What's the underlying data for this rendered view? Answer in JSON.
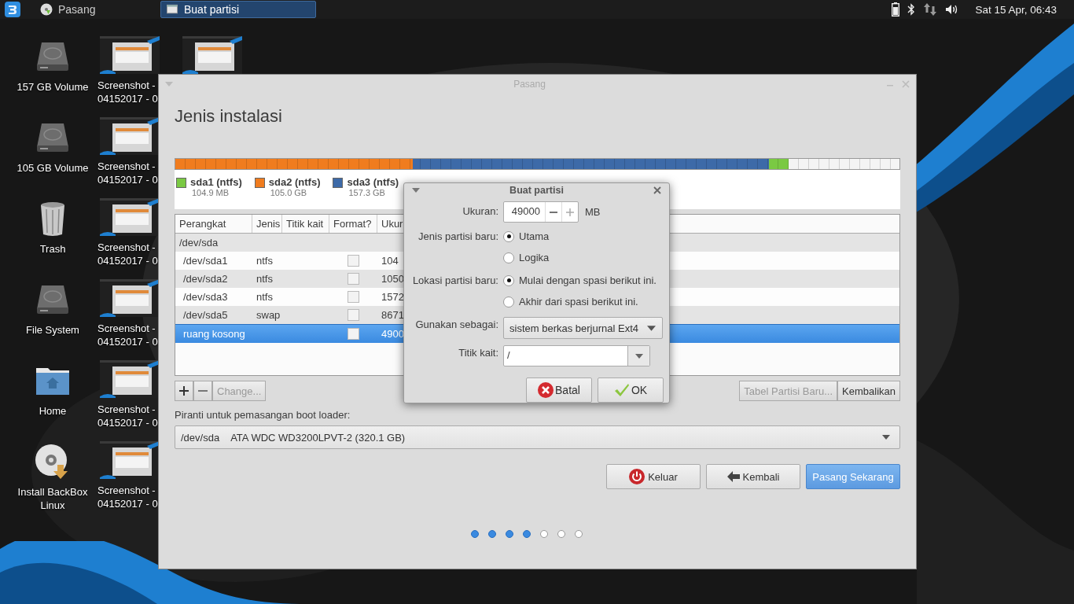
{
  "top_panel": {
    "tasks": [
      {
        "label": "Pasang",
        "kind": "installer",
        "selected": false
      },
      {
        "label": "Buat partisi",
        "kind": "window",
        "selected": true
      }
    ],
    "clock": "Sat 15 Apr, 06:43"
  },
  "desktop_icons": [
    {
      "label": "157 GB Volume",
      "kind": "drive"
    },
    {
      "label": "105 GB Volume",
      "kind": "drive"
    },
    {
      "label": "Trash",
      "kind": "trash"
    },
    {
      "label": "File System",
      "kind": "drive"
    },
    {
      "label": "Home",
      "kind": "folder"
    },
    {
      "label": "Install BackBox Linux",
      "kind": "disc"
    }
  ],
  "desktop_files": [
    {
      "kind": "screenshot",
      "lines": [
        "Screenshot -",
        "04152017 - 0"
      ]
    },
    {
      "kind": "screenshot",
      "lines": [
        "Screenshot -",
        "04152017 - 0"
      ]
    },
    {
      "kind": "screenshot",
      "lines": [
        "Screenshot -",
        "04152017 - 0"
      ]
    },
    {
      "kind": "screenshot",
      "lines": [
        "Screenshot -",
        "04152017 - 0"
      ]
    },
    {
      "kind": "screenshot",
      "lines": [
        "Screenshot -",
        "04152017 - 0"
      ]
    },
    {
      "kind": "screenshot",
      "lines": [
        "Screenshot -",
        "04152017 - 0"
      ]
    },
    {
      "kind": "screenshot"
    }
  ],
  "window": {
    "title": "Pasang",
    "heading": "Jenis instalasi",
    "partition_bar": [
      {
        "color": "#7ac943",
        "level": 0.847
      },
      {
        "color": "#3d6aa8",
        "level": 0.82
      },
      {
        "color": "#f07c1e",
        "level": 0.328
      }
    ],
    "legend": [
      {
        "name": "sda1 (ntfs)",
        "size": "104.9 MB",
        "color": "#7ac943"
      },
      {
        "name": "sda2 (ntfs)",
        "size": "105.0 GB",
        "color": "#f07c1e"
      },
      {
        "name": "sda3 (ntfs)",
        "size": "157.3 GB",
        "color": "#3d6aa8"
      }
    ],
    "table": {
      "columns": [
        "Perangkat",
        "Jenis",
        "Titik kait",
        "Format?",
        "Ukur"
      ],
      "rows": [
        {
          "kind": "group",
          "device": "/dev/sda",
          "selected": false
        },
        {
          "kind": "partition",
          "device": "/dev/sda1",
          "type": "ntfs",
          "format": false,
          "size": "104",
          "selected": false
        },
        {
          "kind": "partition",
          "device": "/dev/sda2",
          "type": "ntfs",
          "format": false,
          "size": "1050",
          "selected": false
        },
        {
          "kind": "partition",
          "device": "/dev/sda3",
          "type": "ntfs",
          "format": false,
          "size": "1572",
          "selected": false
        },
        {
          "kind": "partition",
          "device": "/dev/sda5",
          "type": "swap",
          "format": false,
          "size": "8671",
          "selected": false
        },
        {
          "kind": "partition",
          "device": "ruang kosong",
          "format": false,
          "size": "4900",
          "selected": true
        }
      ]
    },
    "table_tools": [
      {
        "kind": "add",
        "disabled": false
      },
      {
        "kind": "remove",
        "disabled": false
      },
      {
        "kind": "text",
        "label": "Change...",
        "disabled": true
      }
    ],
    "table_actions": [
      {
        "label": "Tabel Partisi Baru...",
        "disabled": true
      },
      {
        "label": "Kembalikan",
        "disabled": false
      }
    ],
    "boot_loader": {
      "label": "Piranti untuk pemasangan boot loader:",
      "device": "/dev/sda",
      "description": "ATA WDC WD3200LPVT-2 (320.1 GB)"
    },
    "buttons": [
      {
        "label": "Keluar",
        "kind": "quit"
      },
      {
        "label": "Kembali",
        "kind": "back"
      },
      {
        "label": "Pasang Sekarang",
        "kind": "install"
      }
    ],
    "steps": [
      {
        "done": true
      },
      {
        "done": true
      },
      {
        "done": true
      },
      {
        "done": true
      },
      {
        "done": false
      },
      {
        "done": false
      },
      {
        "done": false
      }
    ]
  },
  "dialog": {
    "title": "Buat partisi",
    "size_label": "Ukuran:",
    "size": "49000",
    "unit": "MB",
    "type_label": "Jenis partisi baru:",
    "type_options": [
      {
        "label": "Utama",
        "selected": true
      },
      {
        "label": "Logika",
        "selected": false
      }
    ],
    "location_label": "Lokasi partisi baru:",
    "location_options": [
      {
        "label": "Mulai dengan spasi berikut ini.",
        "selected": true
      },
      {
        "label": "Akhir dari spasi berikut ini.",
        "selected": false
      }
    ],
    "use_label": "Gunakan sebagai:",
    "use_value": "sistem berkas berjurnal Ext4",
    "mount_label": "Titik kait:",
    "mount_value": "/",
    "buttons": [
      {
        "label": "Batal",
        "kind": "cancel"
      },
      {
        "label": "OK",
        "kind": "ok"
      }
    ]
  }
}
